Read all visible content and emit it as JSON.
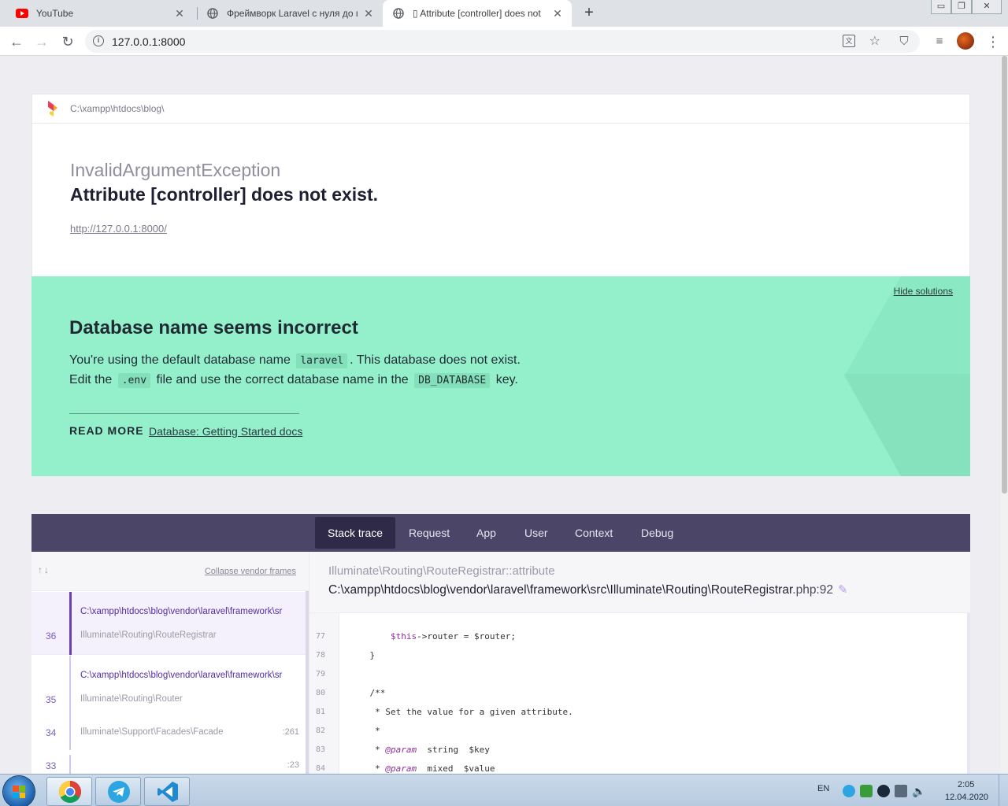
{
  "browser": {
    "tabs": [
      {
        "title": "YouTube",
        "favicon": "youtube-icon"
      },
      {
        "title": "Фреймворк Laravel с нуля до пр",
        "favicon": "globe-icon"
      },
      {
        "title": "▯ Attribute [controller] does not",
        "favicon": "globe-icon",
        "active": true
      }
    ],
    "url": "127.0.0.1:8000",
    "new_tab": "+"
  },
  "page": {
    "project_path": "C:\\xampp\\htdocs\\blog\\",
    "exception_class": "InvalidArgumentException",
    "exception_message": "Attribute [controller] does not exist.",
    "request_url": "http://127.0.0.1:8000/",
    "solution": {
      "hide_label": "Hide solutions",
      "title": "Database name seems incorrect",
      "line1_pre": "You're using the default database name",
      "line1_code": "laravel",
      "line1_post": ". This database does not exist.",
      "line2_pre": "Edit the",
      "line2_code1": ".env",
      "line2_mid": "file and use the correct database name in the",
      "line2_code2": "DB_DATABASE",
      "line2_post": "key.",
      "read_more": "READ MORE",
      "read_link": "Database: Getting Started docs",
      "color": "#94f0cb"
    },
    "tabs": [
      "Stack trace",
      "Request",
      "App",
      "User",
      "Context",
      "Debug"
    ],
    "active_tab": "Stack trace",
    "frames_header": {
      "collapse_label": "Collapse vendor frames"
    },
    "frames": [
      {
        "number": "36",
        "file": "C:\\xampp\\htdocs\\blog\\vendor\\laravel\\framework\\sr",
        "class": "Illuminate\\Routing\\RouteRegistrar",
        "line": ""
      },
      {
        "number": "35",
        "file": "C:\\xampp\\htdocs\\blog\\vendor\\laravel\\framework\\sr",
        "class": "Illuminate\\Routing\\Router",
        "line": ""
      },
      {
        "number": "34",
        "file": "",
        "class": "Illuminate\\Support\\Facades\\Facade",
        "line": ":261"
      },
      {
        "number": "33",
        "file": "",
        "class": "",
        "line": ":23"
      }
    ],
    "code": {
      "function": "Illuminate\\Routing\\RouteRegistrar::attribute",
      "file": "C:\\xampp\\htdocs\\blog\\vendor\\laravel\\framework\\src\\Illuminate\\Routing\\RouteRegistrar",
      "file_suffix": ".php:92",
      "lines": [
        {
          "no": "77",
          "text": "        $this->router = $router;"
        },
        {
          "no": "78",
          "text": "    }"
        },
        {
          "no": "79",
          "text": ""
        },
        {
          "no": "80",
          "text": "    /**"
        },
        {
          "no": "81",
          "text": "     * Set the value for a given attribute."
        },
        {
          "no": "82",
          "text": "     *"
        },
        {
          "no": "83",
          "text": "     * @param  string  $key"
        },
        {
          "no": "84",
          "text": "     * @param  mixed  $value"
        }
      ]
    }
  },
  "taskbar": {
    "lang": "EN",
    "time": "2:05",
    "date": "12.04.2020"
  }
}
